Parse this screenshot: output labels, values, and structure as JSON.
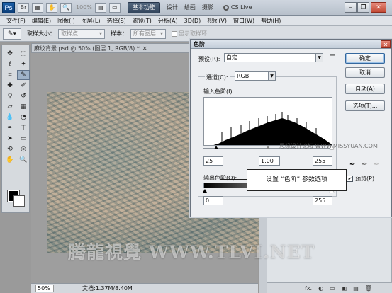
{
  "app": {
    "logo": "Ps",
    "zoom": "100%",
    "workspace_active": "基本功能",
    "workspaces": [
      "设计",
      "绘画",
      "摄影"
    ],
    "cslive": "CS Live"
  },
  "menu": [
    "文件(F)",
    "编辑(E)",
    "图像(I)",
    "图层(L)",
    "选择(S)",
    "滤镜(T)",
    "分析(A)",
    "3D(D)",
    "视图(V)",
    "窗口(W)",
    "帮助(H)"
  ],
  "options": {
    "sample_size_label": "取样大小：",
    "sample_size_value": "取样点",
    "sample_label": "样本：",
    "sample_value": "所有图层",
    "show_ring": "显示取样环"
  },
  "document": {
    "tab_title": "麻纹背景.psd @ 50% (图层 1, RGB/8) *",
    "zoom": "50%",
    "doc_size": "文档:1.37M/8.40M"
  },
  "levels": {
    "title": "色阶",
    "preset_label": "预设(R):",
    "preset_value": "自定",
    "channel_label": "通道(C):",
    "channel_value": "RGB",
    "input_levels_label": "输入色阶(I):",
    "input_black": "25",
    "input_gamma": "1.00",
    "input_white": "255",
    "output_levels_label": "输出色阶(O):",
    "output_black": "0",
    "output_white": "255",
    "buttons": {
      "ok": "确定",
      "cancel": "取消",
      "auto": "自动(A)",
      "options": "选项(T)..."
    },
    "preview_label": "预览(P)"
  },
  "callout": "设置 “色阶” 参数选项",
  "watermark_small": "思缘设计论坛 WWW.MISSYUAN.COM",
  "watermark_big": "腾龍視覺 WWW.TLVI.NET",
  "layers_footer": [
    "fx.",
    "◐",
    "▭",
    "▣",
    "▤",
    "🗑"
  ]
}
